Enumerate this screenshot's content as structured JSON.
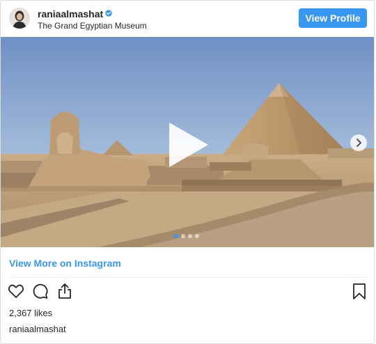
{
  "header": {
    "username": "raniaalmashat",
    "verified_icon": "verified-badge-icon",
    "location": "The Grand Egyptian Museum",
    "view_profile_label": "View Profile",
    "accent_color": "#3897f0"
  },
  "media": {
    "type": "video",
    "play_icon": "play-icon",
    "next_icon": "chevron-right-icon",
    "carousel": {
      "count": 4,
      "active_index": 1
    }
  },
  "footer": {
    "view_more_label": "View More on Instagram",
    "actions": [
      "heart-icon",
      "comment-icon",
      "share-icon",
      "bookmark-icon"
    ],
    "likes": "2,367 likes",
    "caption_username": "raniaalmashat"
  }
}
